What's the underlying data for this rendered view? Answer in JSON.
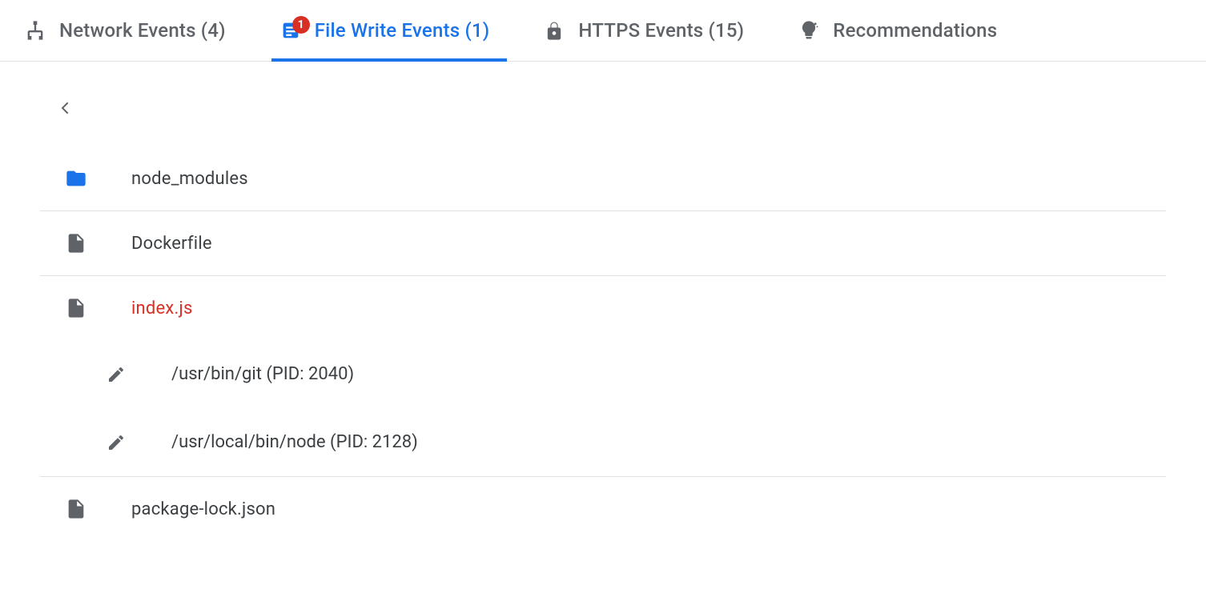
{
  "tabs": [
    {
      "id": "network",
      "label": "Network Events (4)",
      "badge": null
    },
    {
      "id": "file",
      "label": "File Write Events (1)",
      "badge": "1",
      "active": true
    },
    {
      "id": "https",
      "label": "HTTPS Events (15)",
      "badge": null
    },
    {
      "id": "recs",
      "label": "Recommendations",
      "badge": null
    }
  ],
  "files": {
    "items": [
      {
        "name": "node_modules",
        "icon": "folder",
        "highlight": false
      },
      {
        "name": "Dockerfile",
        "icon": "file",
        "highlight": false
      },
      {
        "name": "index.js",
        "icon": "file",
        "highlight": true,
        "children": [
          {
            "text": "/usr/bin/git (PID: 2040)"
          },
          {
            "text": "/usr/local/bin/node (PID: 2128)"
          }
        ]
      },
      {
        "name": "package-lock.json",
        "icon": "file",
        "highlight": false
      }
    ]
  }
}
